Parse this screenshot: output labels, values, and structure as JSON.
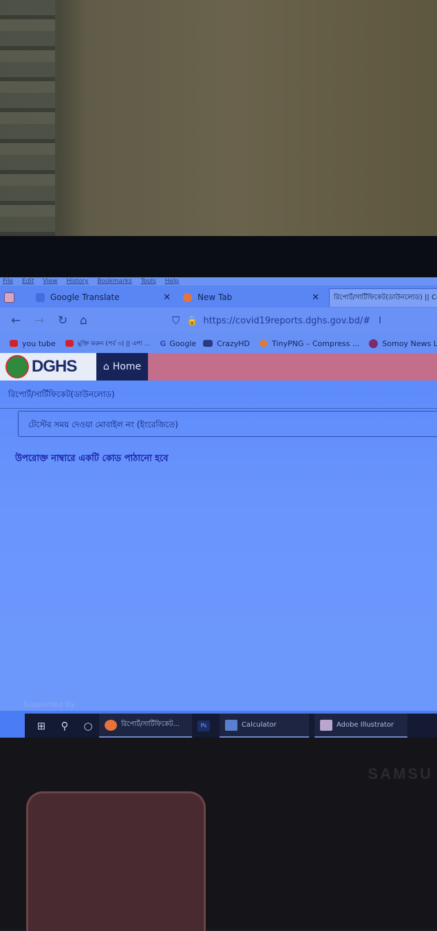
{
  "menu": [
    "File",
    "Edit",
    "View",
    "History",
    "Bookmarks",
    "Tools",
    "Help"
  ],
  "tabs": [
    {
      "label": "Google Translate",
      "close": "✕"
    },
    {
      "label": "New Tab",
      "close": "✕"
    },
    {
      "label": "রিপোর্ট/সার্টিফিকেট(ডাউনলোড) || Covid R"
    }
  ],
  "address": {
    "url": "https://covid19reports.dghs.gov.bd/#"
  },
  "bookmarks": [
    {
      "label": "you tube",
      "color": "#d4202a"
    },
    {
      "label": "মুক্তি করুন (পর্ব ৩) || এশা ...",
      "color": "#d4202a"
    },
    {
      "label": "Google",
      "color": "#4a6fd0"
    },
    {
      "label": "CrazyHD",
      "color": "#2a3a80"
    },
    {
      "label": "TinyPNG – Compress ...",
      "color": "#e07a3a"
    },
    {
      "label": "Somoy News LIV",
      "color": "#7d2b6e"
    }
  ],
  "site": {
    "logo": "DGHS",
    "home": "Home"
  },
  "page": {
    "title": "রিপোর্ট/সার্টিফিকেট(ডাউনলোড)",
    "mobile_placeholder": "টেস্টের সময় দেওয়া মোবাইল নং (ইংরেজিতে)",
    "hint": "উপরোক্ত নাম্বারে একটি কোড পাঠানো হবে",
    "supported": "Supported By"
  },
  "taskbar": {
    "apps": [
      {
        "label": "রিপোর্ট/সার্টিফিকেট...",
        "color": "#e8733a"
      },
      {
        "label": "",
        "color": "#1b2d66",
        "text": "Ps"
      },
      {
        "label": "Calculator",
        "color": "#5a7fd0"
      },
      {
        "label": "Adobe Illustrator",
        "color": "#b9a6cf"
      }
    ]
  },
  "monitor_brand": "SAMSU"
}
